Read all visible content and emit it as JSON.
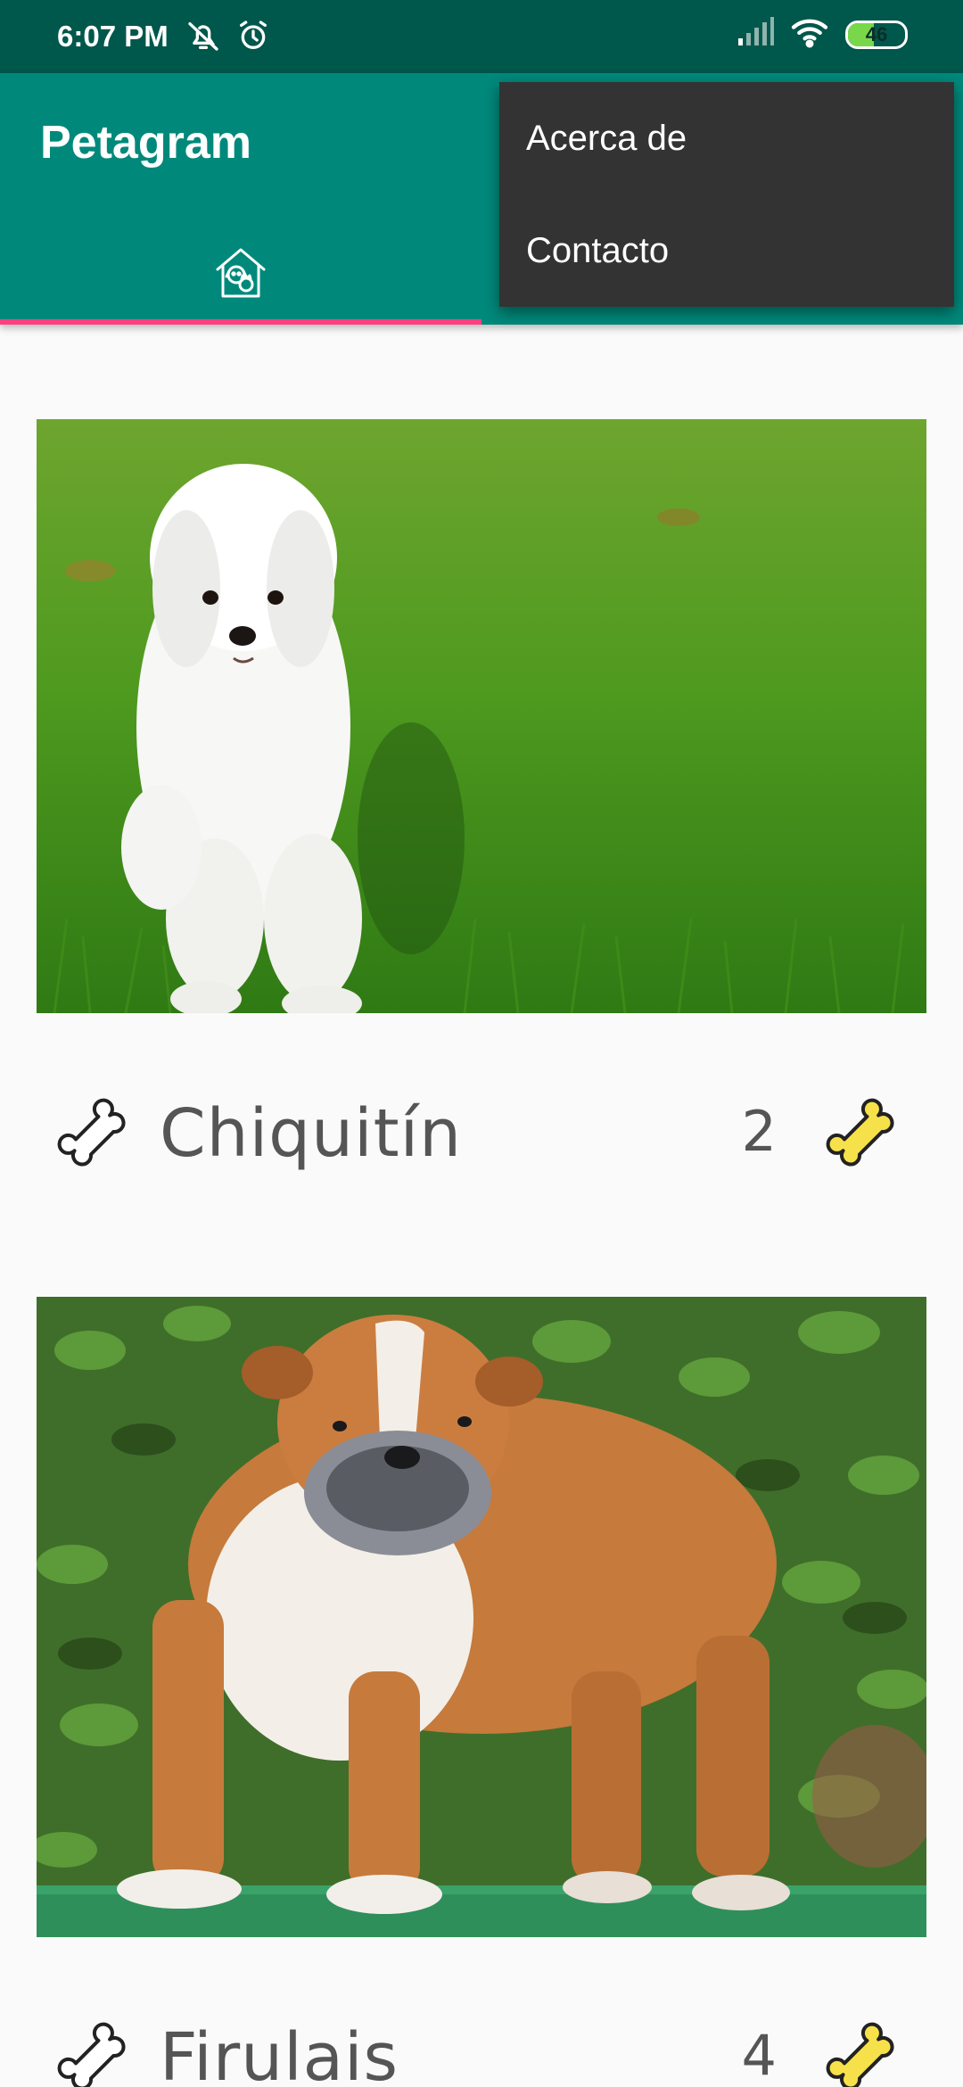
{
  "status_bar": {
    "time": "6:07 PM",
    "battery_level": "46",
    "icons": [
      "mute-notifications-icon",
      "alarm-icon",
      "signal-icon",
      "wifi-icon",
      "battery-icon"
    ]
  },
  "app_bar": {
    "title": "Petagram",
    "tabs": [
      {
        "icon": "pet-house-icon",
        "selected": true
      }
    ],
    "colors": {
      "primary": "#00897b",
      "primary_dark": "#00574b",
      "accent": "#ff4081"
    }
  },
  "overflow_menu": {
    "items": [
      {
        "label": "Acerca de"
      },
      {
        "label": "Contacto"
      }
    ]
  },
  "pets": [
    {
      "name": "Chiquitín",
      "likes": "2",
      "photo": "white maltese dog sitting on grass"
    },
    {
      "name": "Firulais",
      "likes": "4",
      "photo": "english bulldog standing in front of bushes"
    }
  ]
}
